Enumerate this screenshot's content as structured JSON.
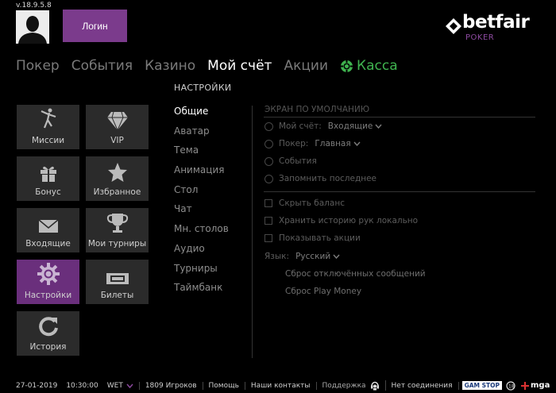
{
  "app": {
    "version": "v.18.9.5.8"
  },
  "header": {
    "login_label": "Логин",
    "logo_text": "betfair",
    "logo_sub": "POKER"
  },
  "nav": [
    {
      "label": "Покер"
    },
    {
      "label": "События"
    },
    {
      "label": "Казино"
    },
    {
      "label": "Мой счёт"
    },
    {
      "label": "Акции"
    },
    {
      "label": "Касса"
    }
  ],
  "tiles": [
    {
      "label": "Миссии",
      "icon": "dancer-icon"
    },
    {
      "label": "VIP",
      "icon": "diamond-icon"
    },
    {
      "label": "Бонус",
      "icon": "gift-icon"
    },
    {
      "label": "Избранное",
      "icon": "star-icon"
    },
    {
      "label": "Входящие",
      "icon": "envelope-icon"
    },
    {
      "label": "Мои турниры",
      "icon": "trophy-icon"
    },
    {
      "label": "Настройки",
      "icon": "gear-icon"
    },
    {
      "label": "Билеты",
      "icon": "ticket-icon"
    },
    {
      "label": "История",
      "icon": "refresh-icon"
    }
  ],
  "settings": {
    "title": "НАСТРОЙКИ",
    "menu": [
      "Общие",
      "Аватар",
      "Тема",
      "Анимация",
      "Стол",
      "Чат",
      "Мн. столов",
      "Аудио",
      "Турниры",
      "Таймбанк"
    ],
    "default_screen": {
      "title": "ЭКРАН ПО УМОЛЧАНИЮ",
      "my_account_label": "Мой счёт:",
      "my_account_value": "Входящие",
      "poker_label": "Покер:",
      "poker_value": "Главная",
      "events_label": "События",
      "remember_label": "Запомнить последнее"
    },
    "hide_balance": "Скрыть баланс",
    "store_history": "Хранить историю рук локально",
    "show_promos": "Показывать акции",
    "language_label": "Язык:",
    "language_value": "Русский",
    "reset_messages": "Сброс отключённых сообщений",
    "reset_playmoney": "Сброс Play Money"
  },
  "footer": {
    "date": "27-01-2019",
    "time": "10:30:00",
    "timezone": "WET",
    "players": "1809 Игроков",
    "help": "Помощь",
    "contacts": "Наши контакты",
    "support": "Поддержка",
    "connection": "Нет соединения",
    "gamstop": "GAM STOP",
    "mga": "mga"
  },
  "colors": {
    "accent": "#7b3b8c",
    "kassa": "#3fb34f",
    "tile": "#2b2b2b"
  }
}
